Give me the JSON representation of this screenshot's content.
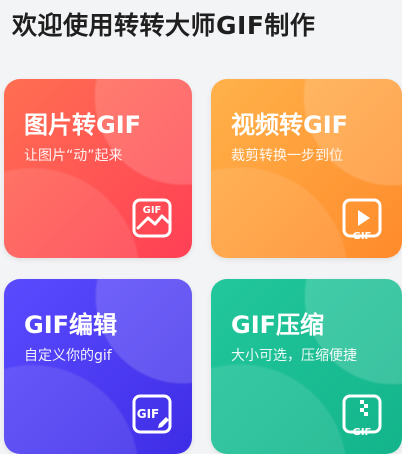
{
  "page": {
    "title": "欢迎使用转转大师GIF制作"
  },
  "cards": [
    {
      "title": "图片转GIF",
      "subtitle": "让图片“动”起来",
      "icon": "image-to-gif-icon"
    },
    {
      "title": "视频转GIF",
      "subtitle": "裁剪转换一步到位",
      "icon": "video-to-gif-icon"
    },
    {
      "title": "GIF编辑",
      "subtitle": "自定义你的gif",
      "icon": "gif-edit-icon"
    },
    {
      "title": "GIF压缩",
      "subtitle": "大小可选，压缩便捷",
      "icon": "gif-compress-icon"
    }
  ],
  "icons": {
    "gif_text": "GIF"
  }
}
